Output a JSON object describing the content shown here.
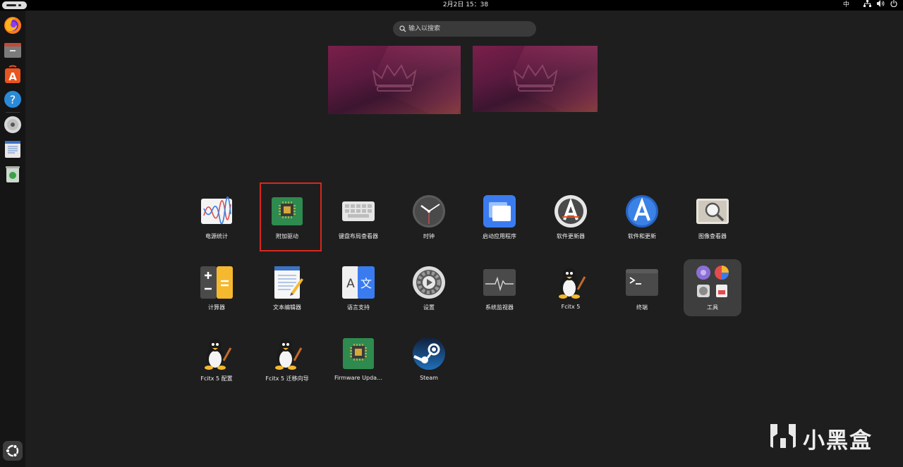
{
  "topbar": {
    "datetime": "2月2日  15：38",
    "input_method": "中"
  },
  "dock": {
    "items": [
      "firefox-icon",
      "files-icon",
      "app-center-icon",
      "help-icon",
      "disc-icon",
      "text-editor-icon",
      "trash-icon"
    ]
  },
  "search": {
    "placeholder": "输入以搜索"
  },
  "apps": [
    {
      "label": "电源统计",
      "icon": "power-statistics-icon"
    },
    {
      "label": "附加驱动",
      "icon": "additional-drivers-icon"
    },
    {
      "label": "键盘布局查看器",
      "icon": "keyboard-layout-icon"
    },
    {
      "label": "时钟",
      "icon": "clock-icon"
    },
    {
      "label": "启动应用程序",
      "icon": "startup-apps-icon"
    },
    {
      "label": "软件更新器",
      "icon": "software-updater-icon"
    },
    {
      "label": "软件和更新",
      "icon": "software-sources-icon"
    },
    {
      "label": "图像查看器",
      "icon": "image-viewer-icon"
    },
    {
      "label": "计算器",
      "icon": "calculator-icon"
    },
    {
      "label": "文本编辑器",
      "icon": "text-editor-icon"
    },
    {
      "label": "语言支持",
      "icon": "language-support-icon"
    },
    {
      "label": "设置",
      "icon": "settings-icon"
    },
    {
      "label": "系统监视器",
      "icon": "system-monitor-icon"
    },
    {
      "label": "Fcitx 5",
      "icon": "tux-icon"
    },
    {
      "label": "终端",
      "icon": "terminal-icon"
    },
    {
      "label": "Fcitx 5 配置",
      "icon": "tux-icon"
    },
    {
      "label": "Fcitx 5 迁移向导",
      "icon": "tux-icon"
    },
    {
      "label": "Firmware Upda…",
      "icon": "firmware-updater-icon"
    },
    {
      "label": "Steam",
      "icon": "steam-icon"
    }
  ],
  "folder": {
    "label": "工具"
  },
  "watermark": {
    "text": "小黑盒"
  },
  "colors": {
    "highlight": "#d8281f",
    "ubuntu_orange": "#e95420",
    "background": "#1e1e1e"
  }
}
